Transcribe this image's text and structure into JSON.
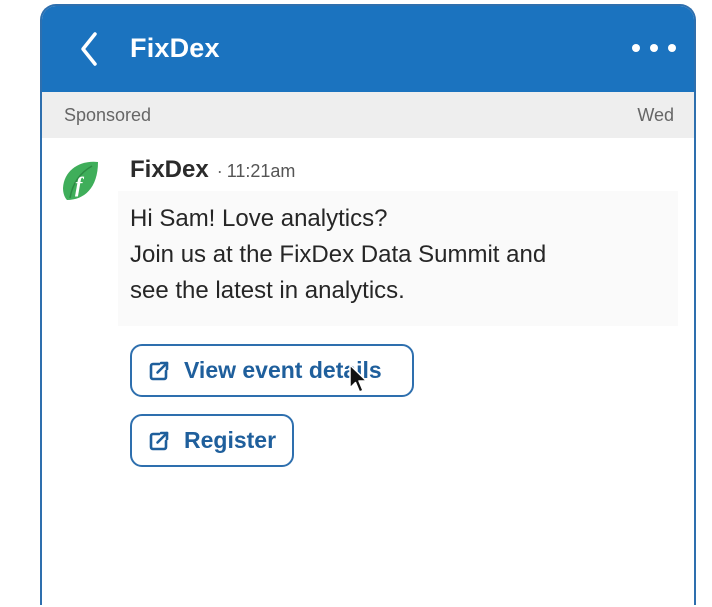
{
  "header": {
    "title": "FixDex",
    "back_icon": "chevron-left-icon",
    "more_icon": "more-horizontal-icon"
  },
  "sponsor_bar": {
    "label": "Sponsored",
    "day": "Wed"
  },
  "message": {
    "sender": "FixDex",
    "separator": "·",
    "time": "11:21am",
    "avatar_icon": "fixdex-leaf-logo",
    "lines": [
      "Hi Sam! Love analytics?",
      "Join us at the FixDex Data Summit and",
      "see the latest in analytics."
    ]
  },
  "actions": {
    "view_details_label": "View event details",
    "register_label": "Register",
    "action_icon": "external-link-icon"
  },
  "colors": {
    "header_bg": "#1b73bf",
    "accent": "#2e6fae",
    "button_text": "#1f5f9c",
    "logo_green": "#3fae5a",
    "sponsor_bar_bg": "#eeeeee"
  }
}
